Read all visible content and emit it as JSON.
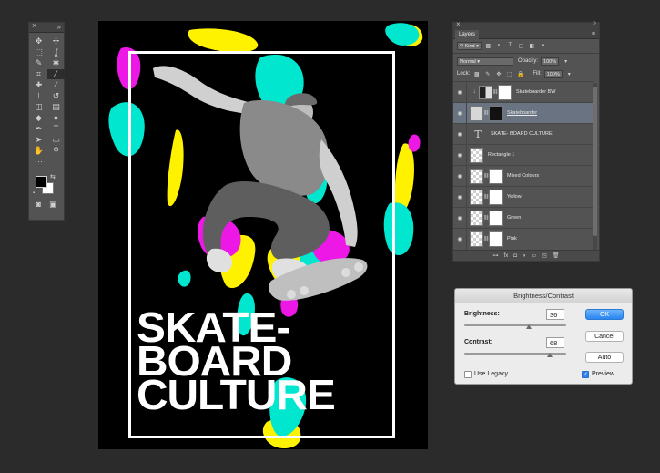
{
  "tools": {
    "close_glyph": "×",
    "grip_glyph": "»",
    "items": [
      {
        "name": "move-tool",
        "glyph": "✥"
      },
      {
        "name": "artboard-tool",
        "glyph": "✢"
      },
      {
        "name": "marquee-tool",
        "glyph": "⬚"
      },
      {
        "name": "lasso-tool",
        "glyph": "ʆ"
      },
      {
        "name": "quick-select-tool",
        "glyph": "✎"
      },
      {
        "name": "magic-wand-tool",
        "glyph": "✱"
      },
      {
        "name": "crop-tool",
        "glyph": "⌗"
      },
      {
        "name": "eyedropper-tool",
        "glyph": "⁄"
      },
      {
        "name": "healing-brush-tool",
        "glyph": "✚"
      },
      {
        "name": "brush-tool",
        "glyph": "∕"
      },
      {
        "name": "clone-stamp-tool",
        "glyph": "⊥"
      },
      {
        "name": "history-brush-tool",
        "glyph": "↺"
      },
      {
        "name": "eraser-tool",
        "glyph": "◫"
      },
      {
        "name": "gradient-tool",
        "glyph": "▤"
      },
      {
        "name": "blur-tool",
        "glyph": "◆"
      },
      {
        "name": "dodge-tool",
        "glyph": "●"
      },
      {
        "name": "pen-tool",
        "glyph": "✒"
      },
      {
        "name": "type-tool",
        "glyph": "T"
      },
      {
        "name": "path-select-tool",
        "glyph": "➤"
      },
      {
        "name": "shape-tool",
        "glyph": "▭"
      },
      {
        "name": "hand-tool",
        "glyph": "✋"
      },
      {
        "name": "zoom-tool",
        "glyph": "⚲"
      },
      {
        "name": "more-tools",
        "glyph": "···"
      },
      {
        "name": "edit-toolbar",
        "glyph": ""
      }
    ],
    "foreground_color": "#000000",
    "background_color": "#ffffff",
    "swap_glyph": "⇆",
    "default_glyph": "▪",
    "quick_mask_glyph": "◙",
    "screen_mode_glyph": "▣"
  },
  "poster": {
    "title_lines": [
      "SKATE-",
      "BOARD",
      "CULTURE"
    ],
    "colors": {
      "background": "#000000",
      "frame": "#ffffff",
      "yellow": "#fff200",
      "cyan": "#00e6cf",
      "magenta": "#ee18e6"
    }
  },
  "layers_panel": {
    "close_glyph": "×",
    "grip_glyph": "»",
    "tab_label": "Layers",
    "menu_glyph": "≡",
    "filter_label": "Kind",
    "blend_mode": "Normal",
    "opacity_label": "Opacity:",
    "opacity_value": "100%",
    "lock_label": "Lock:",
    "fill_label": "Fill:",
    "fill_value": "100%",
    "layers": [
      {
        "name": "Skateboarder BW",
        "type": "adjustment",
        "selected": false
      },
      {
        "name": "Skateboarder",
        "type": "masked",
        "selected": true
      },
      {
        "name": "SKATE- BOARD CULTURE",
        "type": "text",
        "selected": false
      },
      {
        "name": "Rectangle 1",
        "type": "shape",
        "selected": false
      },
      {
        "name": "Mixed Colours",
        "type": "masked",
        "selected": false
      },
      {
        "name": "Yellow",
        "type": "masked",
        "selected": false
      },
      {
        "name": "Green",
        "type": "masked",
        "selected": false
      },
      {
        "name": "Pink",
        "type": "masked",
        "selected": false
      }
    ],
    "footer_icons": [
      {
        "name": "link-layers-icon",
        "glyph": "⊶"
      },
      {
        "name": "fx-icon",
        "glyph": "fx"
      },
      {
        "name": "add-mask-icon",
        "glyph": "◘"
      },
      {
        "name": "new-adjustment-icon",
        "glyph": "◑"
      },
      {
        "name": "new-group-icon",
        "glyph": "▭"
      },
      {
        "name": "new-layer-icon",
        "glyph": "◳"
      },
      {
        "name": "delete-layer-icon",
        "glyph": "🗑"
      }
    ]
  },
  "brightness_contrast": {
    "title": "Brightness/Contrast",
    "brightness_label": "Brightness:",
    "brightness_value": "36",
    "contrast_label": "Contrast:",
    "contrast_value": "68",
    "ok_label": "OK",
    "cancel_label": "Cancel",
    "auto_label": "Auto",
    "use_legacy_label": "Use Legacy",
    "use_legacy_checked": false,
    "preview_label": "Preview",
    "preview_checked": true,
    "check_glyph": "✓"
  }
}
